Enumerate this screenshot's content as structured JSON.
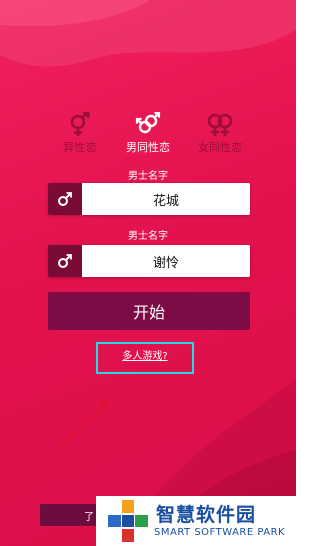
{
  "tabs": [
    {
      "label": "异性恋",
      "icon": "hetero-gender-icon",
      "active": false
    },
    {
      "label": "男同性恋",
      "icon": "gay-gender-icon",
      "active": true
    },
    {
      "label": "女同性恋",
      "icon": "lesbian-gender-icon",
      "active": false
    }
  ],
  "player1": {
    "label": "男士名字",
    "value": "花城",
    "icon": "male-symbol-icon"
  },
  "player2": {
    "label": "男士名字",
    "value": "谢怜",
    "icon": "male-symbol-icon"
  },
  "start_label": "开始",
  "multiplayer_label": "多人游戏?",
  "bottom_button_partial": "了",
  "watermark": {
    "title": "智慧软件园",
    "subtitle": "SMART SOFTWARE PARK"
  },
  "colors": {
    "background": "#e3124d",
    "dark": "#7a0a36",
    "button": "#7d0b45",
    "highlight": "#27d9e8"
  }
}
